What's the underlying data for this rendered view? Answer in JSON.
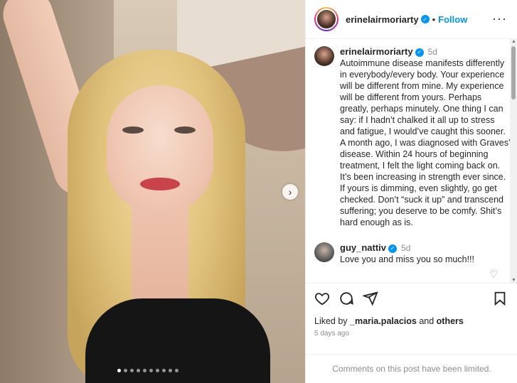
{
  "post": {
    "author": "erinelairmoriarty",
    "follow_label": "Follow",
    "separator": "•",
    "more_glyph": "···"
  },
  "caption": {
    "username": "erinelairmoriarty",
    "time": "5d",
    "text": "Autoimmune disease manifests differently in everybody/every body. Your experience will be different from mine. My experience will be different from yours. Perhaps greatly, perhaps minutely. One thing I can say: if I hadn’t chalked it all up to stress and fatigue, I would’ve caught this sooner. A month ago, I was diagnosed with Graves’ disease. Within 24 hours of beginning treatment, I felt the light coming back on. It’s been increasing in strength ever since. If yours is dimming, even slightly, go get checked. Don’t “suck it up” and transcend suffering; you deserve to be comfy. Shit’s hard enough as is."
  },
  "comments": [
    {
      "username": "guy_nattiv",
      "time": "5d",
      "text": "Love you and miss you so much!!!"
    }
  ],
  "likes": {
    "prefix": "Liked by ",
    "user": "_maria.palacios",
    "middle": " and ",
    "others": "others"
  },
  "posted_ago": "5 days ago",
  "comments_limited": "Comments on this post have been limited.",
  "carousel": {
    "slide_count": 10,
    "active_index": 0
  },
  "colors": {
    "accent": "#0095f6",
    "text": "#262626",
    "muted": "#8e8e8e"
  },
  "icons": [
    "more-icon",
    "verified-icon",
    "heart-icon",
    "comment-icon",
    "share-icon",
    "bookmark-icon",
    "next-arrow-icon"
  ]
}
